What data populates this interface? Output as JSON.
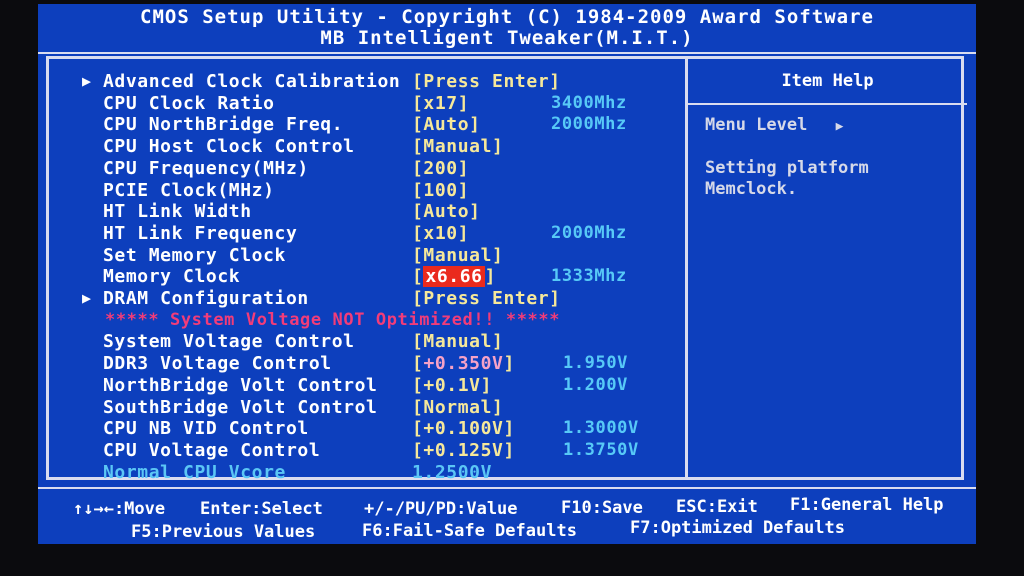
{
  "header": {
    "line1": "CMOS Setup Utility - Copyright (C) 1984-2009 Award Software",
    "line2": "MB Intelligent Tweaker(M.I.T.)"
  },
  "menu": {
    "rows": [
      {
        "label": "Advanced Clock Calibration",
        "value": "[Press Enter]",
        "info": "",
        "submenu": true
      },
      {
        "label": "CPU Clock Ratio",
        "value": "[x17]",
        "info": "3400Mhz"
      },
      {
        "label": "CPU NorthBridge Freq.",
        "value": "[Auto]",
        "info": "2000Mhz"
      },
      {
        "label": "CPU Host Clock Control",
        "value": "[Manual]",
        "info": ""
      },
      {
        "label": "CPU Frequency(MHz)",
        "value": "[200]",
        "info": ""
      },
      {
        "label": "PCIE Clock(MHz)",
        "value": "[100]",
        "info": ""
      },
      {
        "label": "HT Link Width",
        "value": "[Auto]",
        "info": ""
      },
      {
        "label": "HT Link Frequency",
        "value": "[x10]",
        "info": "2000Mhz"
      },
      {
        "label": "Set Memory Clock",
        "value": "[Manual]",
        "info": ""
      },
      {
        "label": "Memory Clock",
        "value_prefix": "[",
        "value_selected": "x6.66",
        "value_suffix": "]",
        "info": "1333Mhz",
        "selected": true
      },
      {
        "label": "DRAM Configuration",
        "value": "[Press Enter]",
        "info": "",
        "submenu": true
      },
      {
        "warning": "***** System Voltage NOT Optimized!! *****"
      },
      {
        "label": "System Voltage Control",
        "value": "[Manual]",
        "info": ""
      },
      {
        "label": "DDR3 Voltage Control",
        "value_prefix": "[",
        "value_pink": "+0.350V",
        "value_suffix": "]",
        "info": "1.950V"
      },
      {
        "label": "NorthBridge Volt Control",
        "value": "[+0.1V]",
        "info": "1.200V"
      },
      {
        "label": "SouthBridge Volt Control",
        "value": "[Normal]",
        "info": ""
      },
      {
        "label": "CPU NB VID Control",
        "value": "[+0.100V]",
        "info": "1.3000V"
      },
      {
        "label": "CPU Voltage Control",
        "value": "[+0.125V]",
        "info": "1.3750V"
      },
      {
        "label": "Normal CPU Vcore",
        "value": "1.2500V",
        "info": "",
        "readonly": true
      }
    ]
  },
  "help": {
    "title": "Item Help",
    "menu_level": "Menu Level",
    "menu_level_arrow": "▶",
    "text_line1": "Setting platform",
    "text_line2": "Memclock."
  },
  "footer": {
    "move": "↑↓→←:Move",
    "enter": "Enter:Select",
    "value": "+/-/PU/PD:Value",
    "f10": "F10:Save",
    "esc": "ESC:Exit",
    "f1": "F1:General Help",
    "f5": "F5:Previous Values",
    "f6": "F6:Fail-Safe Defaults",
    "f7": "F7:Optimized Defaults"
  },
  "colors": {
    "background": "#0d3fbd",
    "value": "#f6e89a",
    "info": "#57c9f7",
    "warning": "#f23c79",
    "highlight": "#ea2a1d"
  }
}
